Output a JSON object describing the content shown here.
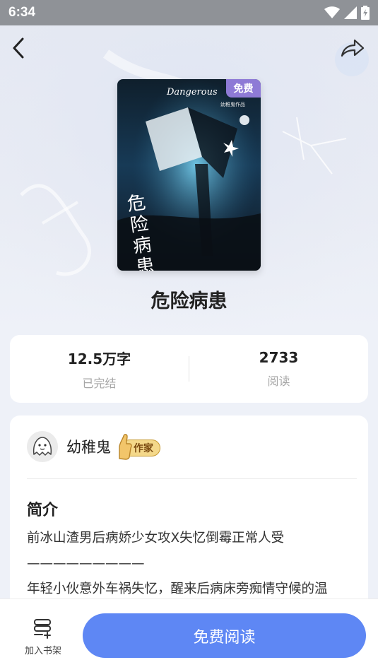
{
  "status_bar": {
    "time": "6:34"
  },
  "book": {
    "title": "危险病患",
    "cover_badge": "免费",
    "cover_title_art": "危险病患",
    "cover_en": "Dangerous",
    "cover_credit": "幼稚鬼作品"
  },
  "stats": [
    {
      "value": "12.5万字",
      "label": "已完结"
    },
    {
      "value": "2733",
      "label": "阅读"
    }
  ],
  "author": {
    "name": "幼稚鬼",
    "tag": "作家"
  },
  "intro": {
    "title": "简介",
    "lines": [
      "前冰山渣男后病娇少女攻X失忆倒霉正常人受",
      "—————————",
      "年轻小伙意外车祸失忆，醒来后病床旁痴情守候的温"
    ]
  },
  "bottom_bar": {
    "shelf_label": "加入书架",
    "read_button": "免费阅读"
  },
  "colors": {
    "accent": "#5e87f4",
    "badge": "#8e7ad6",
    "author_tag": "#f4d88a"
  }
}
